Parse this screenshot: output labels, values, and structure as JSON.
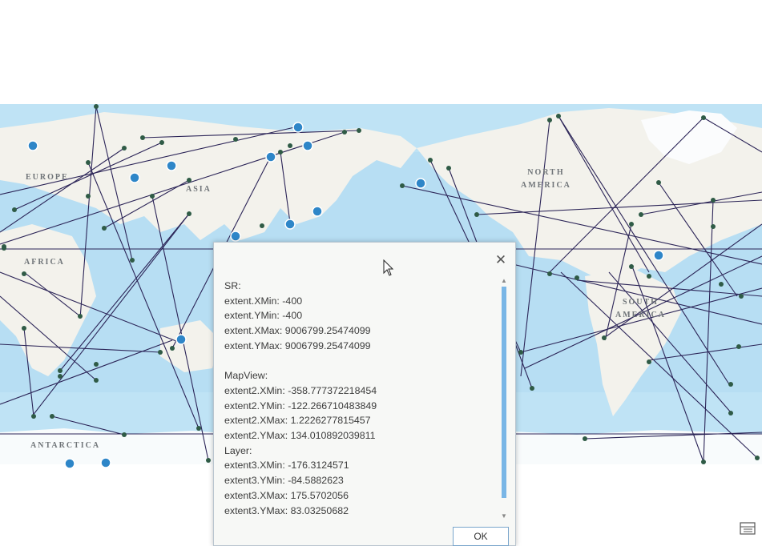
{
  "colors": {
    "ocean": "#bfe3f5",
    "ocean_deep": "#a9d5ef",
    "land": "#f3f2ec",
    "ice": "#f8fbfc",
    "line": "#2b2457",
    "point": "#2f5b46",
    "marker": "#2e86c8",
    "scroll_thumb": "#79b6e6"
  },
  "map": {
    "labels": {
      "europe": "EUROPE",
      "asia": "ASIA",
      "africa": "AFRICA",
      "north_america": "NORTH\nAMERICA",
      "south_america": "SOUTH\nAMERICA",
      "antarctica": "ANTARCTICA"
    }
  },
  "dialog": {
    "close_icon": "close-icon",
    "lines": [
      "SR:",
      "extent.XMin: -400",
      "extent.YMin: -400",
      "extent.XMax: 9006799.25474099",
      "extent.YMax: 9006799.25474099",
      "",
      "MapView:",
      "extent2.XMin: -358.777372218454",
      "extent2.YMin: -122.266710483849",
      "extent2.XMax: 1.2226277815457",
      "extent2.YMax: 134.010892039811",
      "Layer:",
      "extent3.XMin: -176.3124571",
      "extent3.YMin: -84.5882623",
      "extent3.XMax: 175.5702056",
      "extent3.YMax: 83.03250682"
    ],
    "ok_label": "OK"
  }
}
